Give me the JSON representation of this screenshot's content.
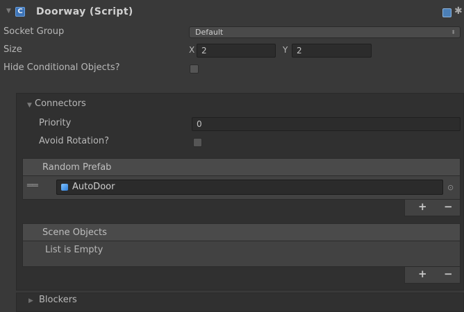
{
  "component": {
    "title": "Doorway (Script)",
    "icon": "csharp-script-icon",
    "header_icons": [
      "help-book-icon",
      "gear-icon"
    ]
  },
  "fields": {
    "socket_group_label": "Socket Group",
    "socket_group_value": "Default",
    "size_label": "Size",
    "size_x_label": "X",
    "size_x_value": "2",
    "size_y_label": "Y",
    "size_y_value": "2",
    "hide_conditional_label": "Hide Conditional Objects?",
    "hide_conditional_checked": false
  },
  "connectors": {
    "label": "Connectors",
    "priority_label": "Priority",
    "priority_value": "0",
    "avoid_rotation_label": "Avoid Rotation?",
    "avoid_rotation_checked": false,
    "random_prefab": {
      "header": "Random Prefab",
      "items": [
        {
          "value": "AutoDoor",
          "icon": "prefab-icon"
        }
      ]
    },
    "scene_objects": {
      "header": "Scene Objects",
      "empty_text": "List is Empty"
    },
    "add_label": "+",
    "remove_label": "−"
  },
  "blockers": {
    "label": "Blockers"
  },
  "colors": {
    "background": "#393939",
    "panel": "#303030",
    "field": "#2c2c2c",
    "text": "#bdbdbd",
    "accent_blue": "#3d74b8"
  }
}
